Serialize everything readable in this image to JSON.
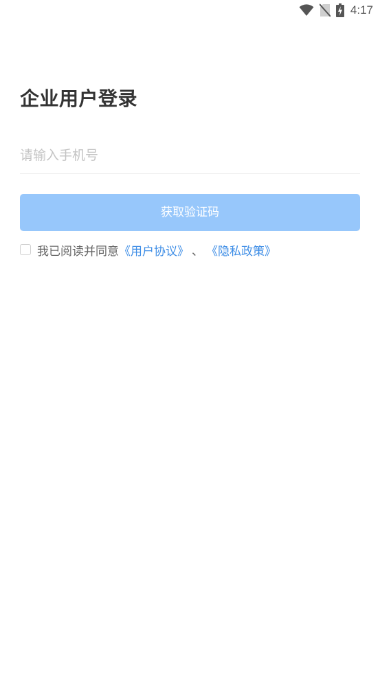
{
  "status_bar": {
    "time": "4:17",
    "icons": [
      "wifi-icon",
      "no-sim-icon",
      "battery-charging-icon"
    ]
  },
  "login": {
    "title": "企业用户登录",
    "phone_placeholder": "请输入手机号",
    "phone_value": "",
    "get_code_label": "获取验证码",
    "agreement_prefix": "我已阅读并同意",
    "user_agreement_link": "《用户协议》",
    "separator": "、",
    "privacy_policy_link": "《隐私政策》",
    "agreement_checked": false
  },
  "colors": {
    "button_bg": "#97c7fb",
    "link": "#3f8ee6",
    "title": "#333333",
    "placeholder": "#c4c4c4"
  }
}
